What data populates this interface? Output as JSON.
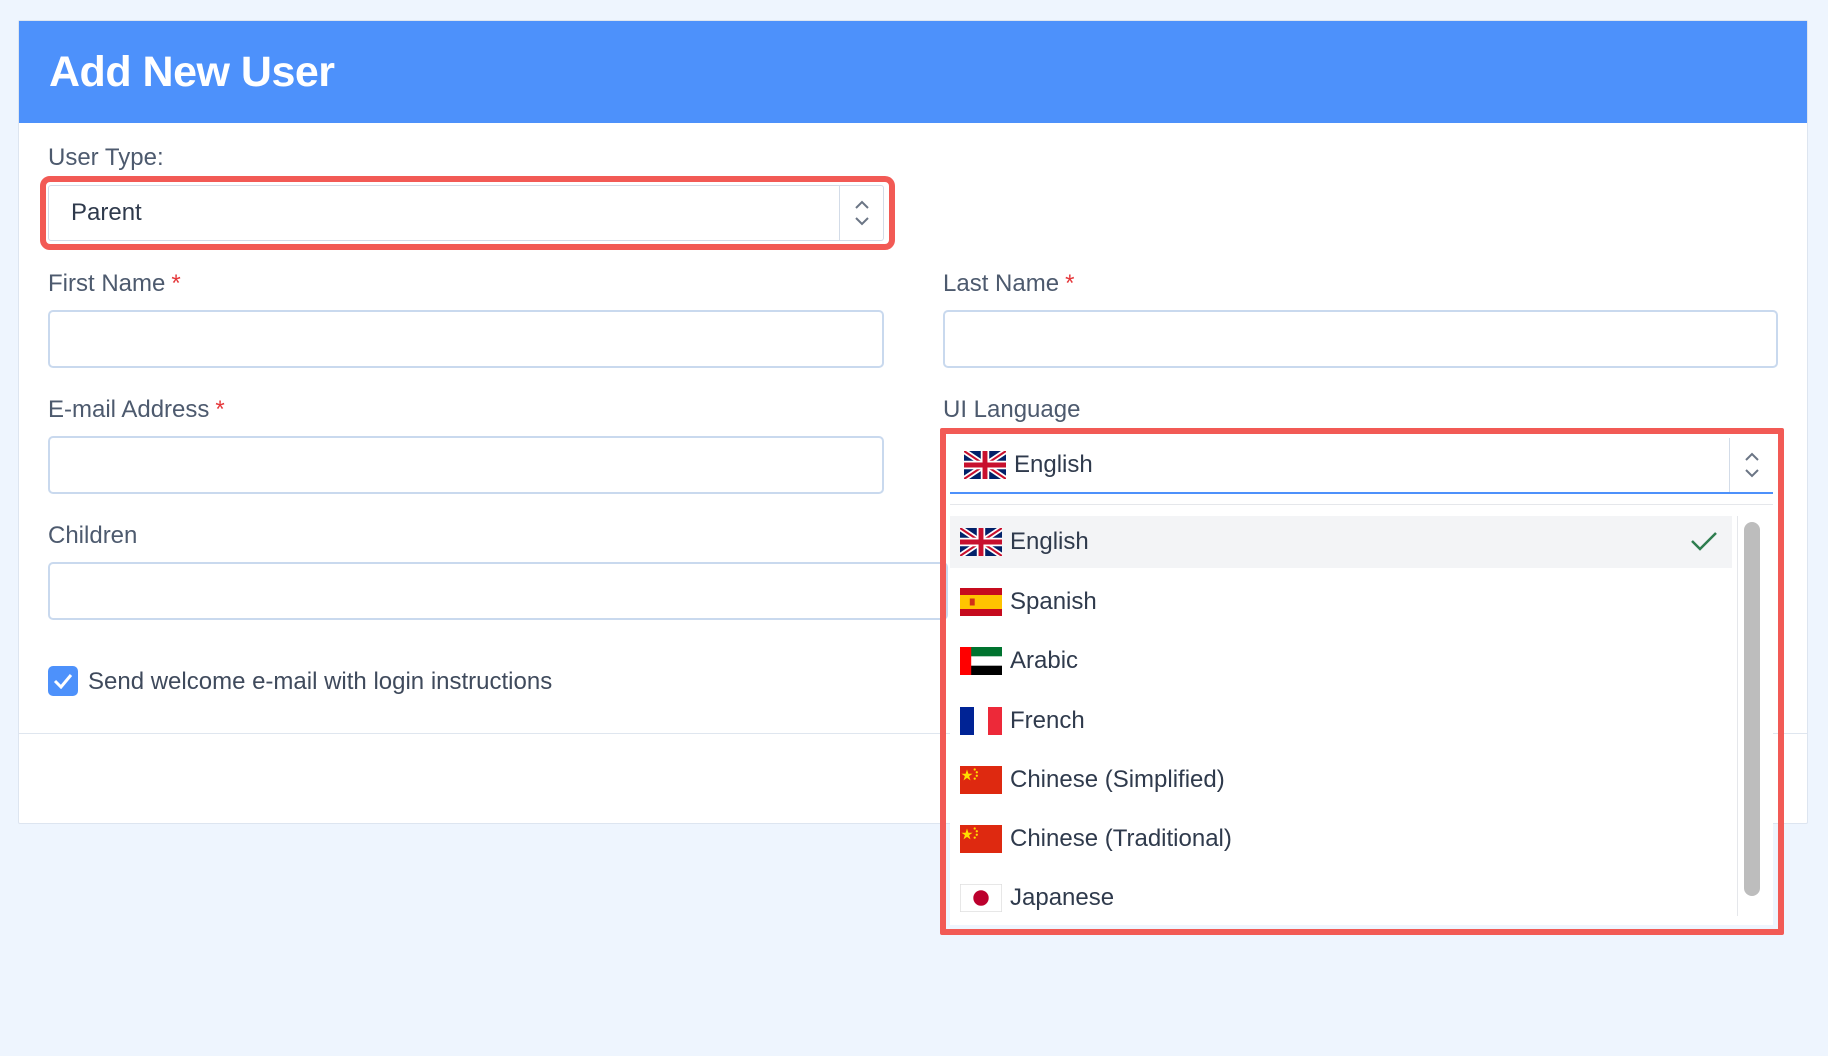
{
  "header": {
    "title": "Add New User"
  },
  "user_type": {
    "label": "User Type:",
    "value": "Parent"
  },
  "first_name": {
    "label": "First Name",
    "required": "*",
    "value": ""
  },
  "last_name": {
    "label": "Last Name",
    "required": "*",
    "value": ""
  },
  "email": {
    "label": "E-mail Address",
    "required": "*",
    "value": ""
  },
  "children": {
    "label": "Children",
    "value": ""
  },
  "welcome_email": {
    "label": "Send welcome e-mail with login instructions",
    "checked": true
  },
  "ui_language": {
    "label": "UI Language",
    "value": "English",
    "options": [
      {
        "label": "English",
        "flag": "uk-flag-icon",
        "selected": true
      },
      {
        "label": "Spanish",
        "flag": "spain-flag-icon"
      },
      {
        "label": "Arabic",
        "flag": "uae-flag-icon"
      },
      {
        "label": "French",
        "flag": "france-flag-icon"
      },
      {
        "label": "Chinese (Simplified)",
        "flag": "china-flag-icon"
      },
      {
        "label": "Chinese (Traditional)",
        "flag": "china-flag-icon"
      },
      {
        "label": "Japanese",
        "flag": "japan-flag-icon"
      }
    ]
  },
  "colors": {
    "accent": "#4d91fb",
    "highlight": "#f25a55",
    "background": "#eef5fe",
    "required": "#e5383b"
  }
}
